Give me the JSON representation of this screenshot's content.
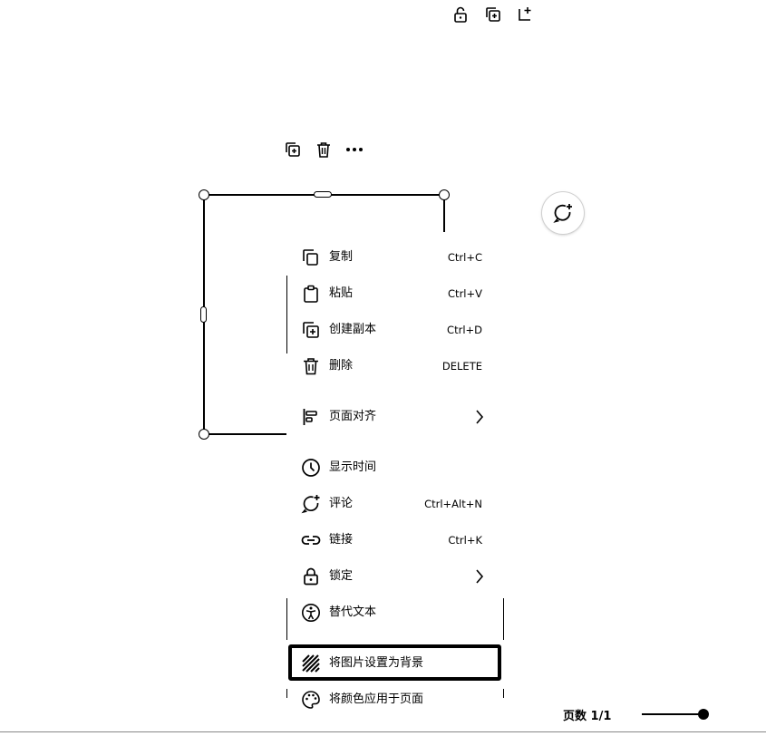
{
  "page_toolbar": {
    "icons": [
      "lock-open-icon",
      "duplicate-page-icon",
      "add-page-icon"
    ]
  },
  "element_toolbar": {
    "icons": [
      "duplicate-icon",
      "trash-icon",
      "more-icon"
    ]
  },
  "context_menu": {
    "items": [
      {
        "icon": "copy-icon",
        "label": "复制",
        "shortcut": "Ctrl+C"
      },
      {
        "icon": "clipboard-icon",
        "label": "粘贴",
        "shortcut": "Ctrl+V"
      },
      {
        "icon": "duplicate-icon",
        "label": "创建副本",
        "shortcut": "Ctrl+D"
      },
      {
        "icon": "trash-icon",
        "label": "删除",
        "shortcut": "DELETE"
      },
      {
        "icon": "align-icon",
        "label": "页面对齐",
        "shortcut": ""
      },
      {
        "icon": "clock-icon",
        "label": "显示时间",
        "shortcut": ""
      },
      {
        "icon": "comment-icon",
        "label": "评论",
        "shortcut": "Ctrl+Alt+N"
      },
      {
        "icon": "link-icon",
        "label": "链接",
        "shortcut": "Ctrl+K"
      },
      {
        "icon": "lock-icon",
        "label": "锁定",
        "shortcut": ""
      },
      {
        "icon": "accessibility-icon",
        "label": "替代文本",
        "shortcut": ""
      },
      {
        "icon": "hatch-icon",
        "label": "将图片设置为背景",
        "shortcut": ""
      },
      {
        "icon": "palette-icon",
        "label": "将颜色应用于页面",
        "shortcut": ""
      }
    ]
  },
  "footer": {
    "page_count": "页数 1/1",
    "zoom_level": 1.0
  }
}
